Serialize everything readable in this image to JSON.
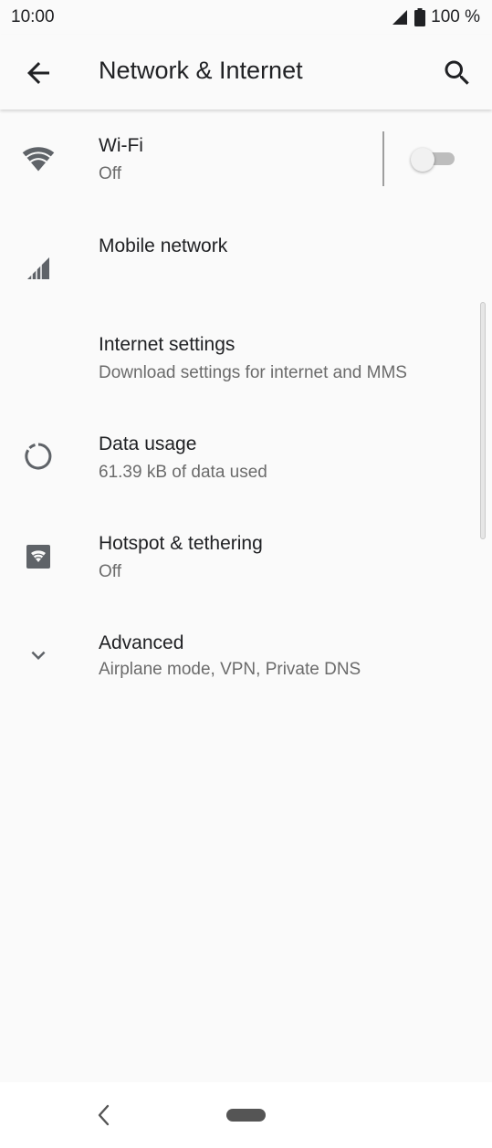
{
  "status_bar": {
    "time": "10:00",
    "battery": "100 %"
  },
  "header": {
    "title": "Network & Internet",
    "back_icon": "arrow-back-icon",
    "search_icon": "search-icon"
  },
  "settings": {
    "items": [
      {
        "title": "Wi-Fi",
        "summary": "Off",
        "icon": "wifi-icon",
        "toggle": false
      },
      {
        "title": "Mobile network",
        "summary": "",
        "icon": "signal-icon"
      },
      {
        "title": "Internet settings",
        "summary": "Download settings for internet and MMS",
        "icon": ""
      },
      {
        "title": "Data usage",
        "summary": "61.39 kB of data used",
        "icon": "data-usage-icon"
      },
      {
        "title": "Hotspot & tethering",
        "summary": "Off",
        "icon": "hotspot-icon"
      },
      {
        "title": "Advanced",
        "summary": "Airplane mode, VPN, Private DNS",
        "icon": "chevron-down-icon"
      }
    ]
  },
  "colors": {
    "background": "#fafafa",
    "primary_text": "#202124",
    "secondary_text": "#6b6b6b",
    "icon": "#5f6368"
  }
}
